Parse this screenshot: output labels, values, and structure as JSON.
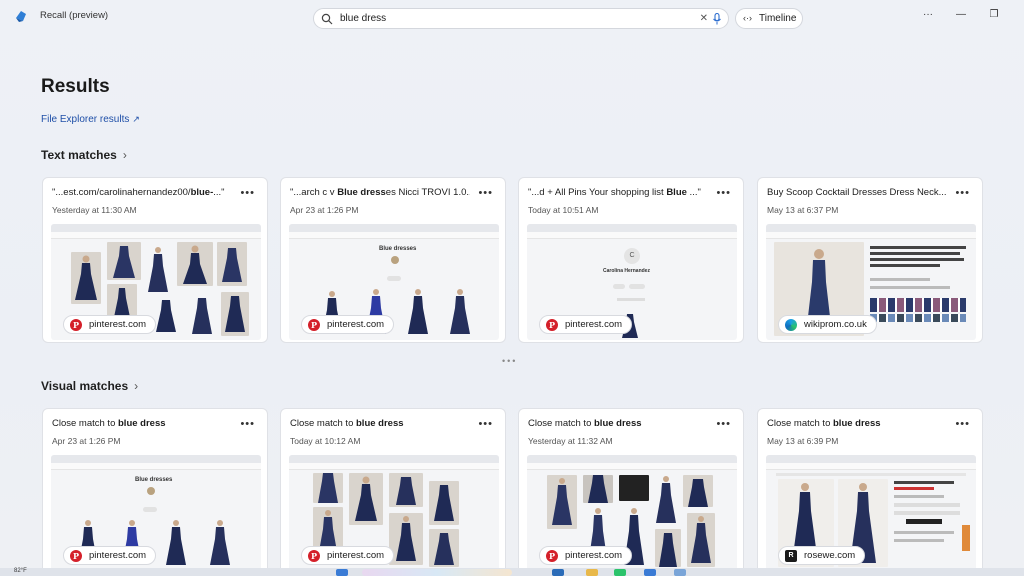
{
  "window": {
    "title": "Recall (preview)"
  },
  "search": {
    "query": "blue dress"
  },
  "timeline": {
    "label": "Timeline"
  },
  "page": {
    "heading": "Results",
    "file_explorer_link": "File Explorer results"
  },
  "text_matches": {
    "heading": "Text matches",
    "cards": [
      {
        "title_pre": "\"...est.com/carolinahernandez00/",
        "title_bold": "blue-",
        "title_post": "...\"",
        "date": "Yesterday at 11:30 AM",
        "source": "pinterest.com",
        "source_icon": "pinterest-icon"
      },
      {
        "title_pre": "\"...arch c v ",
        "title_bold": "Blue dress",
        "title_post": "es Nicci TROVI 1.0...\"",
        "date": "Apr 23 at 1:26 PM",
        "source": "pinterest.com",
        "source_icon": "pinterest-icon",
        "thumb_heading": "Blue dresses"
      },
      {
        "title_pre": "\"...d + All Pins Your shopping list ",
        "title_bold": "Blue",
        "title_post": " ...\"",
        "date": "Today at 10:51 AM",
        "source": "pinterest.com",
        "source_icon": "pinterest-icon",
        "thumb_heading": "Carolina Hernandez"
      },
      {
        "title_pre": "Buy Scoop Cocktail Dresses Dress Neck...",
        "title_bold": "",
        "title_post": "",
        "date": "May 13 at 6:37 PM",
        "source": "wikiprom.co.uk",
        "source_icon": "edge-icon"
      }
    ]
  },
  "visual_matches": {
    "heading": "Visual matches",
    "cards": [
      {
        "title_pre": "Close match to ",
        "title_bold": "blue dress",
        "title_post": "",
        "date": "Apr 23 at 1:26 PM",
        "source": "pinterest.com",
        "source_icon": "pinterest-icon",
        "thumb_heading": "Blue dresses"
      },
      {
        "title_pre": "Close match to ",
        "title_bold": "blue dress",
        "title_post": "",
        "date": "Today at 10:12 AM",
        "source": "pinterest.com",
        "source_icon": "pinterest-icon"
      },
      {
        "title_pre": "Close match to ",
        "title_bold": "blue dress",
        "title_post": "",
        "date": "Yesterday at 11:32 AM",
        "source": "pinterest.com",
        "source_icon": "pinterest-icon"
      },
      {
        "title_pre": "Close match to ",
        "title_bold": "blue dress",
        "title_post": "",
        "date": "May 13 at 6:39 PM",
        "source": "rosewe.com",
        "source_icon": "rosewe-icon"
      }
    ]
  },
  "taskbar": {
    "weather": "82°F"
  },
  "colors": {
    "accent_link": "#1f4fa8",
    "dress_navy": "#1f2a55",
    "pinterest_red": "#d4202a"
  }
}
